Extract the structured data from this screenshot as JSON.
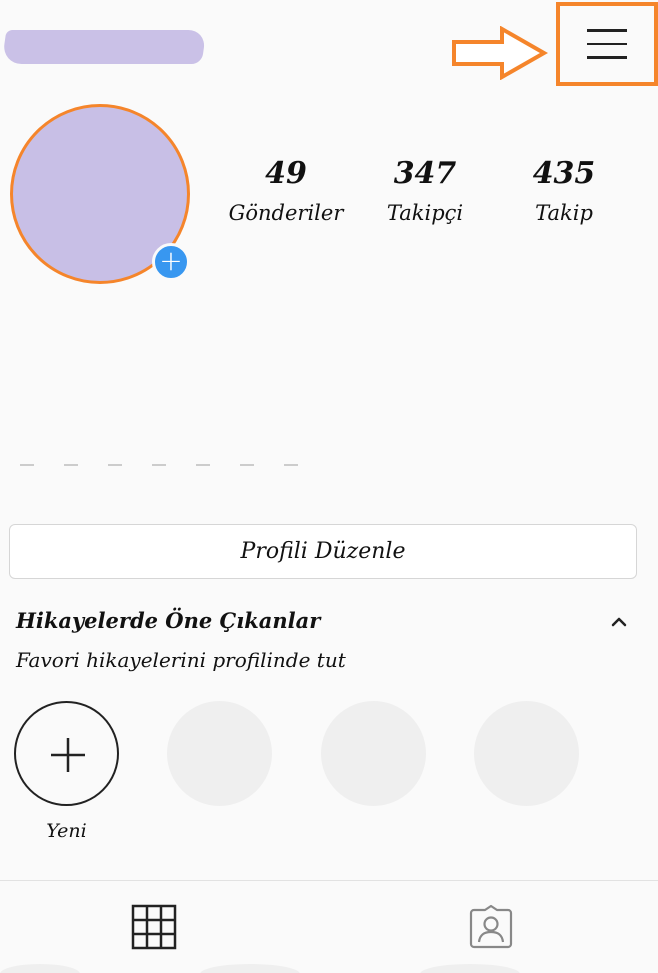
{
  "header": {
    "menu_icon": "hamburger-menu-icon",
    "annotation_icon": "arrow-right-icon",
    "accent_color": "#f5852b"
  },
  "profile": {
    "avatar_add_icon": "plus-icon",
    "avatar_add_symbol": "+"
  },
  "stats": [
    {
      "value": "49",
      "label": "Gönderiler"
    },
    {
      "value": "347",
      "label": "Takipçi"
    },
    {
      "value": "435",
      "label": "Takip"
    }
  ],
  "edit_profile": {
    "label": "Profili Düzenle"
  },
  "highlights": {
    "title": "Hikayelerde Öne Çıkanlar",
    "subtitle": "Favori hikayelerini profilinde tut",
    "new_label": "Yeni",
    "collapse_icon": "chevron-up-icon"
  },
  "tabs": [
    {
      "icon": "grid-icon"
    },
    {
      "icon": "tagged-person-icon"
    }
  ],
  "colors": {
    "avatar_placeholder": "#c8bfe6",
    "add_badge": "#3897f0",
    "background": "#fafafa"
  }
}
